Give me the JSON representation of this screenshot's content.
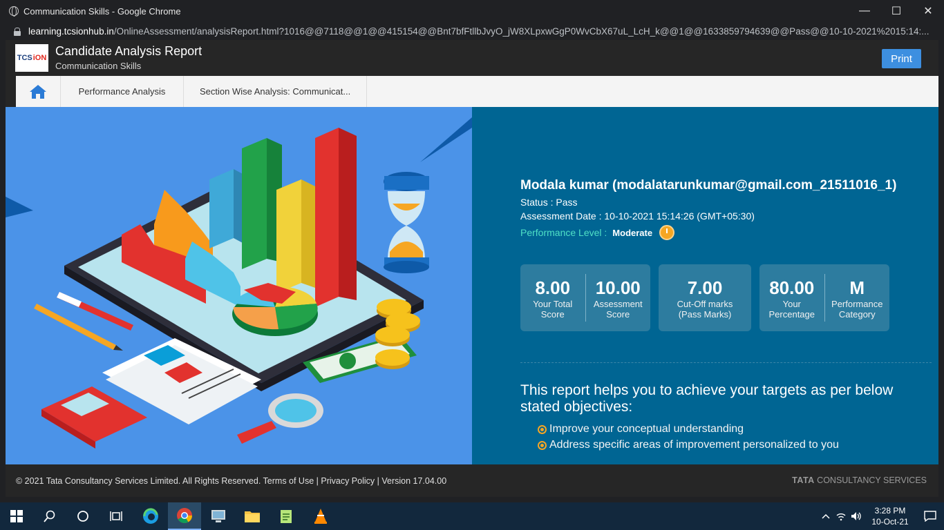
{
  "browser": {
    "window_title": "Communication Skills - Google Chrome",
    "url_host": "learning.tcsionhub.in",
    "url_path": "/OnlineAssessment/analysisReport.html?1016@@7118@@1@@415154@@Bnt7bfFtllbJvyO_jW8XLpxwGgP0WvCbX67uL_LcH_k@@1@@1633859794639@@Pass@@10-10-2021%2015:14:..."
  },
  "header": {
    "logo_tcs": "TCS",
    "logo_ion": "iON",
    "title": "Candidate Analysis Report",
    "subtitle": "Communication Skills",
    "print_label": "Print"
  },
  "tabs": [
    {
      "label": "Performance Analysis"
    },
    {
      "label": "Section Wise Analysis: Communicat..."
    }
  ],
  "candidate": {
    "name": "Modala kumar (modalatarunkumar@gmail.com_21511016_1)",
    "status": "Status : Pass",
    "assessment_date": "Assessment Date : 10-10-2021 15:14:26 (GMT+05:30)",
    "performance_label": "Performance Level :",
    "performance_value": "Moderate"
  },
  "scores": {
    "total_score": {
      "value": "8.00",
      "label_1": "Your Total",
      "label_2": "Score"
    },
    "assessment_score": {
      "value": "10.00",
      "label_1": "Assessment",
      "label_2": "Score"
    },
    "cutoff": {
      "value": "7.00",
      "label_1": "Cut-Off marks",
      "label_2": "(Pass Marks)"
    },
    "percentage": {
      "value": "80.00",
      "label_1": "Your",
      "label_2": "Percentage"
    },
    "category": {
      "value": "M",
      "label_1": "Performance",
      "label_2": "Category"
    }
  },
  "objectives": {
    "title": "This report helps you to achieve your targets as per below stated objectives:",
    "items": [
      "Improve your conceptual understanding",
      "Address specific areas of improvement personalized to you"
    ]
  },
  "footer": {
    "copyright": "© 2021 Tata Consultancy Services Limited. All Rights Reserved.  Terms of Use | Privacy Policy | Version 17.04.00",
    "brand_bold": "TATA",
    "brand_rest": " CONSULTANCY SERVICES"
  },
  "taskbar": {
    "time": "3:28 PM",
    "date": "10-Oct-21"
  },
  "colors": {
    "panel_bg": "#006593",
    "illustration_bg": "#4b93e8",
    "accent_teal": "#4fe0c6",
    "accent_orange": "#f6a623",
    "print_button": "#3d8fe0"
  }
}
